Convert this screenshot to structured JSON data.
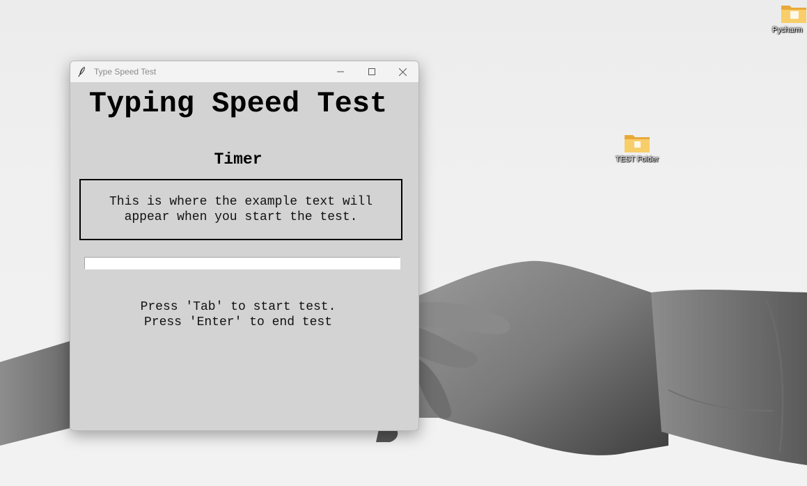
{
  "desktop": {
    "icons": [
      {
        "label": "Pycharm"
      },
      {
        "label": "TEST Folder"
      }
    ]
  },
  "window": {
    "title": "Type Speed Test",
    "controls": {
      "minimize": "minimize-icon",
      "maximize": "maximize-icon",
      "close": "close-icon"
    }
  },
  "app": {
    "heading": "Typing Speed Test",
    "timer_label": "Timer",
    "example_text": "This is where the example text will appear when you start the test.",
    "input_value": "",
    "instructions": [
      "Press 'Tab' to start test.",
      "Press 'Enter' to end test"
    ]
  },
  "colors": {
    "window_bg": "#d3d3d3",
    "titlebar_bg": "#f3f3f3",
    "folder_yellow": "#f6c85f"
  }
}
